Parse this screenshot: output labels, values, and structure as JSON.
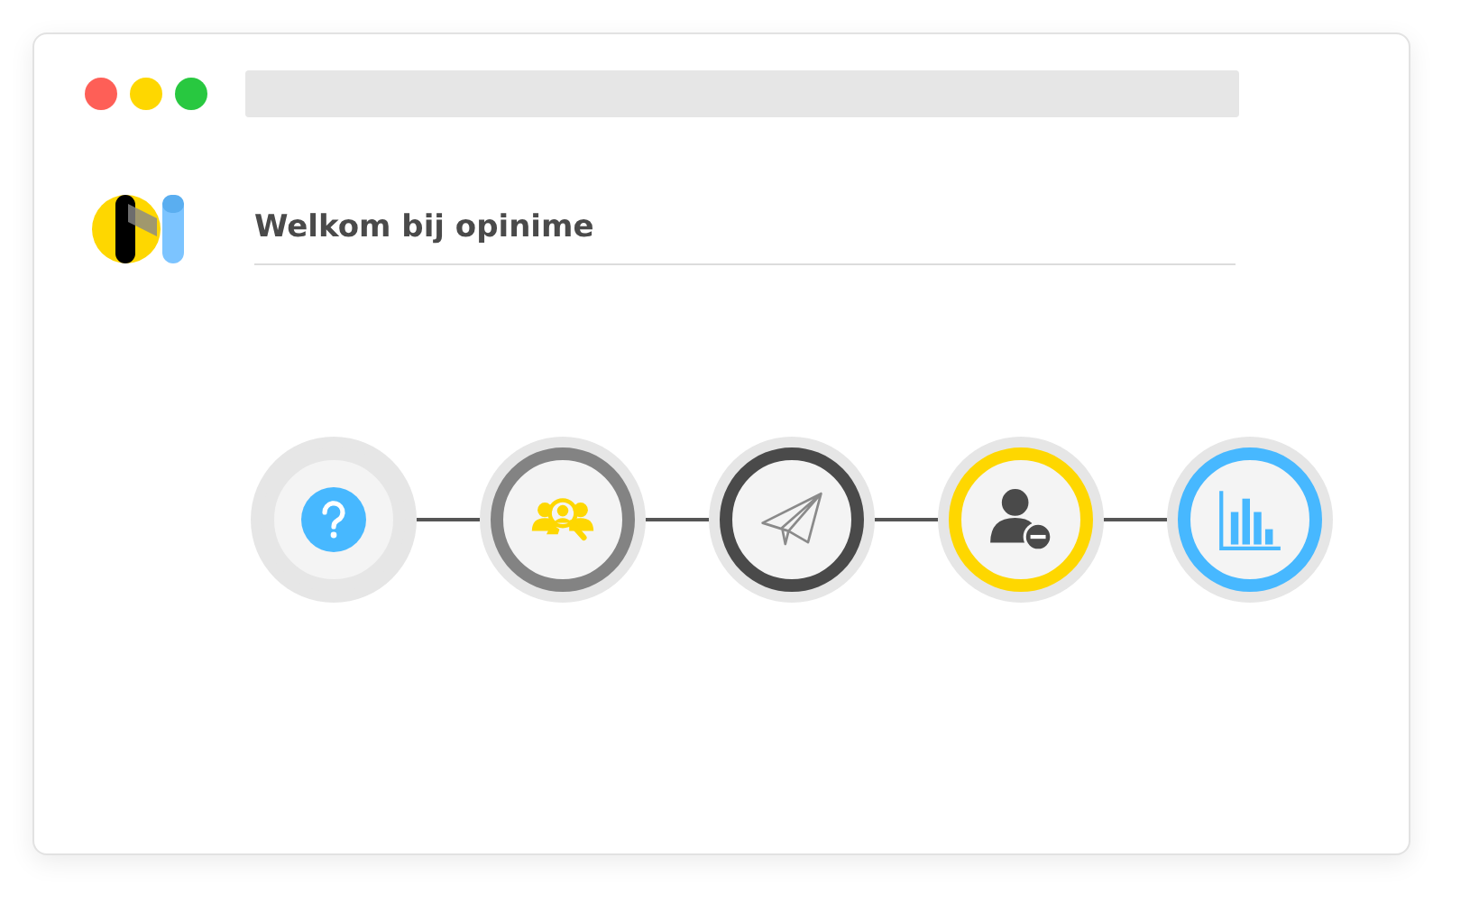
{
  "window": {
    "controls": [
      {
        "color": "#fe5f57"
      },
      {
        "color": "#fed700"
      },
      {
        "color": "#28c840"
      }
    ]
  },
  "header": {
    "title": "Welkom bij opinime"
  },
  "steps": [
    {
      "kind": "question",
      "color": "#e6e6e6"
    },
    {
      "kind": "people-search",
      "color": "#838383"
    },
    {
      "kind": "paper-plane",
      "color": "#4a4a4a"
    },
    {
      "kind": "user-minus",
      "color": "#fed700"
    },
    {
      "kind": "bar-chart",
      "color": "#47b8ff"
    }
  ]
}
